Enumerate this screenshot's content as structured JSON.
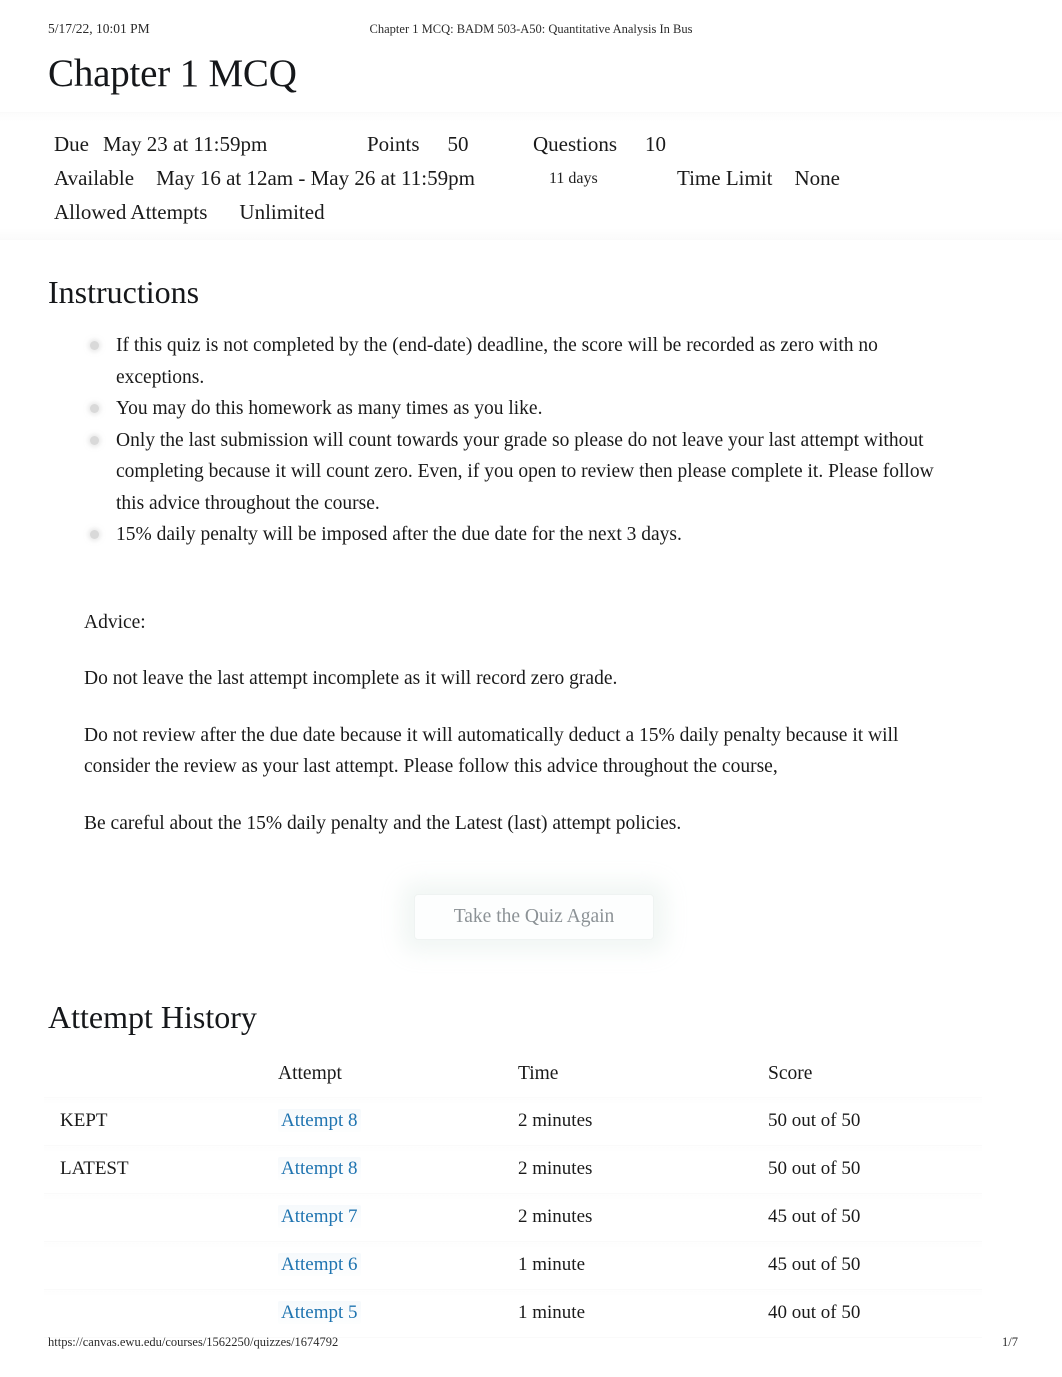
{
  "print": {
    "timestamp": "5/17/22, 10:01 PM",
    "document_title": "Chapter 1 MCQ: BADM 503-A50: Quantitative Analysis In Bus",
    "url": "https://canvas.ewu.edu/courses/1562250/quizzes/1674792",
    "page_number": "1/7"
  },
  "quiz": {
    "title": "Chapter 1 MCQ",
    "details": {
      "due_label": "Due",
      "due_value": "May 23 at 11:59pm",
      "points_label": "Points",
      "points_value": "50",
      "questions_label": "Questions",
      "questions_value": "10",
      "available_label": "Available",
      "available_value": "May 16 at 12am - May 26 at 11:59pm",
      "available_days": "11 days",
      "time_limit_label": "Time Limit",
      "time_limit_value": "None",
      "allowed_attempts_label": "Allowed Attempts",
      "allowed_attempts_value": "Unlimited"
    }
  },
  "instructions": {
    "heading": "Instructions",
    "bullets": [
      "If this quiz is not completed by the (end-date) deadline, the score will be recorded as zero with no exceptions.",
      "You may do this homework as many times as you like.",
      "Only the last submission will count towards your grade so please do not leave your last attempt without completing because it will count zero. Even, if you open to review then please complete it. Please follow this advice throughout the course.",
      "15% daily penalty will be imposed after the due date for the next 3 days."
    ],
    "advice": [
      "Advice:",
      "Do not leave the last attempt incomplete as it will record zero grade.",
      "Do not review after the due date because it will automatically deduct a 15% daily penalty because it will consider the review as your last attempt. Please follow this advice throughout the course,",
      "Be careful about the 15% daily penalty and the Latest (last) attempt policies."
    ]
  },
  "actions": {
    "take_quiz_again": "Take the Quiz Again"
  },
  "attempt_history": {
    "heading": "Attempt History",
    "columns": [
      "",
      "Attempt",
      "Time",
      "Score"
    ],
    "rows": [
      {
        "marker": "KEPT",
        "attempt": "Attempt 8",
        "time": "2 minutes",
        "score": "50 out of 50"
      },
      {
        "marker": "LATEST",
        "attempt": "Attempt 8",
        "time": "2 minutes",
        "score": "50 out of 50"
      },
      {
        "marker": "",
        "attempt": "Attempt 7",
        "time": "2 minutes",
        "score": "45 out of 50"
      },
      {
        "marker": "",
        "attempt": "Attempt 6",
        "time": "1 minute",
        "score": "45 out of 50"
      },
      {
        "marker": "",
        "attempt": "Attempt 5",
        "time": "1 minute",
        "score": "40 out of 50"
      }
    ]
  },
  "colors": {
    "link": "#1f74b0",
    "text": "#1a1a1a",
    "button_text": "#8c9296"
  }
}
